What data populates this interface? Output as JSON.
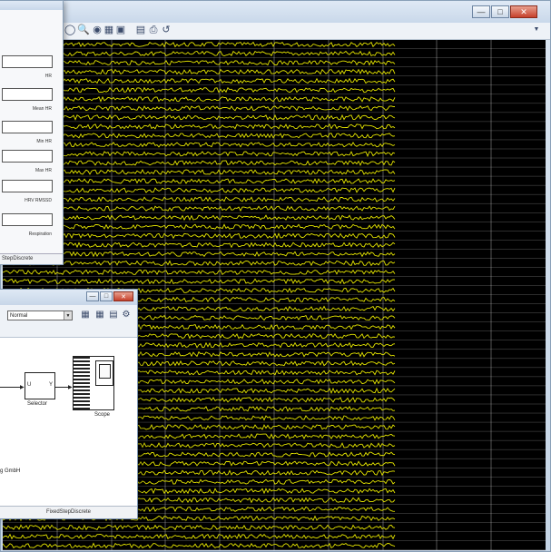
{
  "scope_window": {
    "toolbar_icons": [
      "zoom-icon",
      "binoculars-icon",
      "axes-icon",
      "parameters-icon",
      "save-axes-icon",
      "print-icon",
      "restore-icon"
    ],
    "trace_color": "#e6e600",
    "background": "#000000",
    "grid_color": "#ffffff"
  },
  "display_window": {
    "fields": [
      {
        "label": "HR",
        "value": ""
      },
      {
        "label": "Mean HR",
        "value": ""
      },
      {
        "label": "Min HR",
        "value": ""
      },
      {
        "label": "Max HR",
        "value": ""
      },
      {
        "label": "HRV RMSSD",
        "value": ""
      },
      {
        "label": "Respiration",
        "value": ""
      }
    ],
    "footer": "StepDiscrete"
  },
  "model_window": {
    "simulation_mode": "Normal",
    "blocks": {
      "selector": {
        "label": "Selector",
        "in_port": "U",
        "out_port": "Y"
      },
      "scope": {
        "label": "Scope"
      }
    },
    "canvas_text": "g GmbH",
    "footer": "FixedStepDiscrete"
  }
}
